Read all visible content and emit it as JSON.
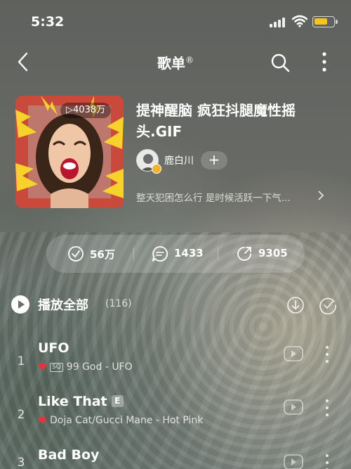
{
  "status": {
    "time": "5:32",
    "battery_color": "#f4c51a"
  },
  "nav": {
    "title": "歌单",
    "title_mark": "®"
  },
  "playlist": {
    "play_count": "▷4038万",
    "title": "提神醒脑 疯狂抖腿魔性摇头.GIF",
    "creator": "鹿白川",
    "follow_label": "+",
    "description": "整天犯困怎么行 是时候活跃一下气..."
  },
  "actions": {
    "favorites": "56万",
    "comments": "1433",
    "shares": "9305"
  },
  "list": {
    "play_all_label": "播放全部",
    "count": "(116)",
    "songs": [
      {
        "index": "1",
        "name": "UFO",
        "quality": "SQ",
        "artist": "99 God - UFO",
        "explicit": ""
      },
      {
        "index": "2",
        "name": "Like That",
        "quality": "",
        "artist": "Doja Cat/Gucci Mane - Hot Pink",
        "explicit": "E"
      },
      {
        "index": "3",
        "name": "Bad Boy",
        "quality": "",
        "artist": "",
        "explicit": ""
      }
    ]
  },
  "colors": {
    "accent_heart": "#e8323c"
  }
}
